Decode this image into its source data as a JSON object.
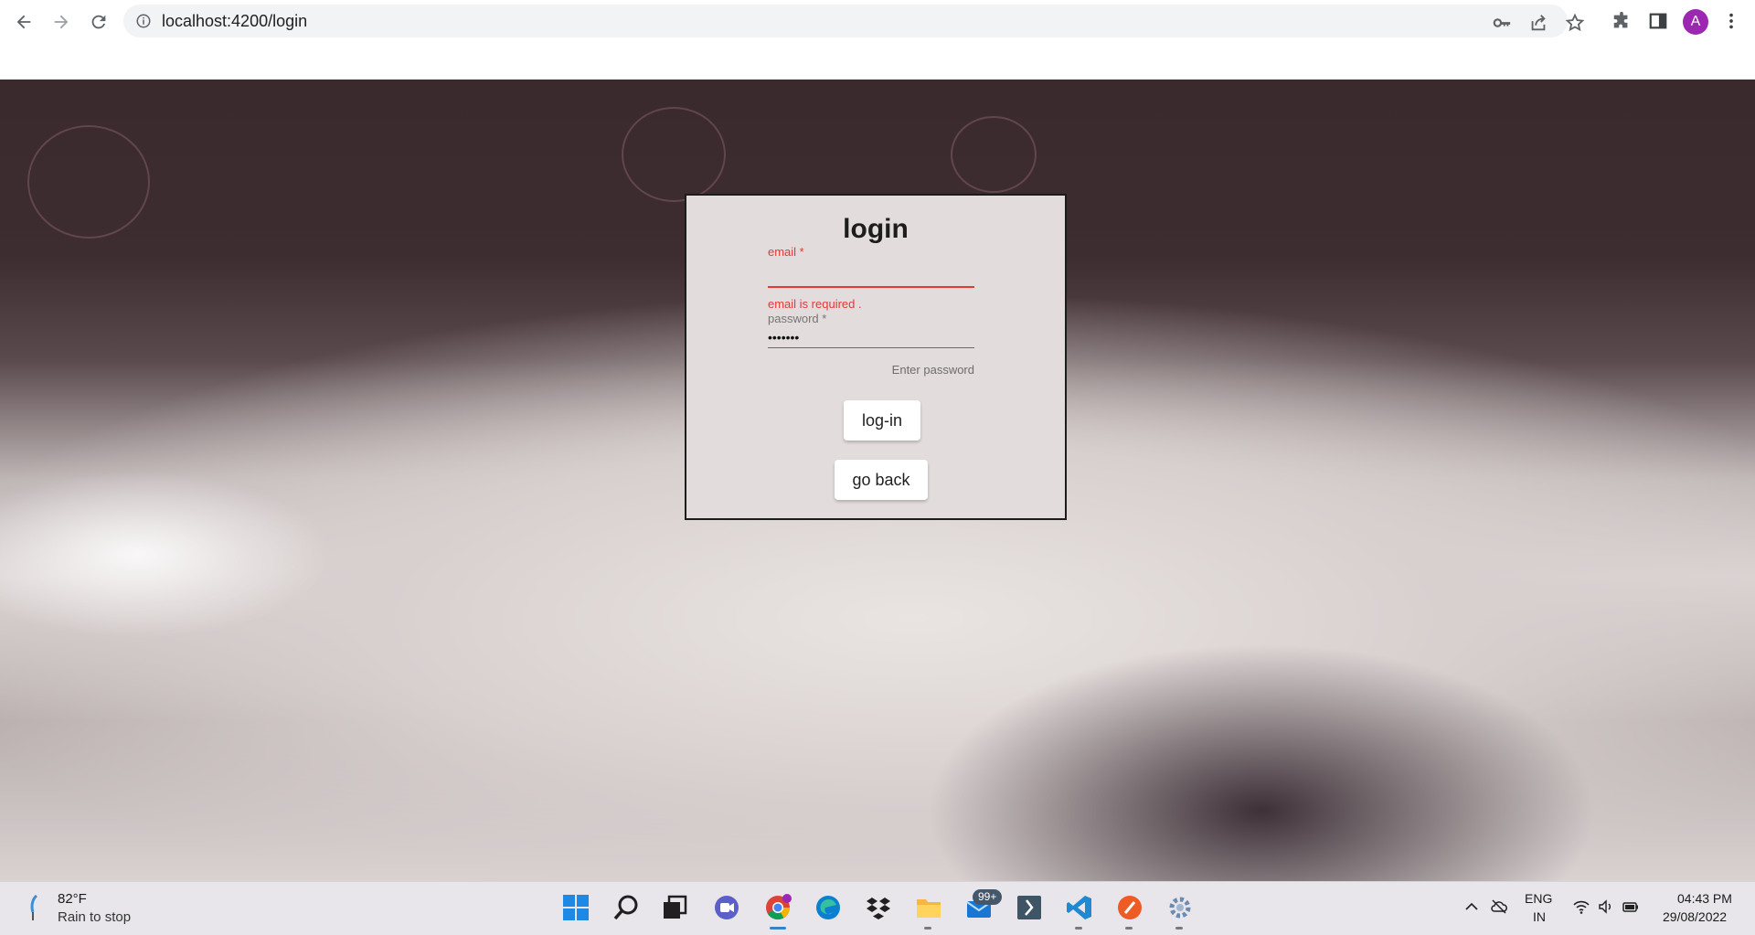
{
  "browser": {
    "url": "localhost:4200/login",
    "profile_initial": "A"
  },
  "login": {
    "title": "login",
    "email": {
      "label": "email *",
      "value": "",
      "error": "email is required ."
    },
    "password": {
      "label": "password *",
      "value": "1234567",
      "hint": "Enter password"
    },
    "login_button": "log-in",
    "back_button": "go back"
  },
  "taskbar": {
    "weather": {
      "temp": "82°F",
      "description": "Rain to stop"
    },
    "mail_badge": "99+",
    "language": {
      "line1": "ENG",
      "line2": "IN"
    },
    "clock": {
      "time": "04:43 PM",
      "date": "29/08/2022"
    }
  },
  "colors": {
    "error": "#e53935",
    "card_background": "#e3dcdc",
    "avatar": "#9c27b0",
    "taskbar": "#e8e6ea"
  },
  "icons": {
    "browser": [
      "back-icon",
      "forward-icon",
      "reload-icon",
      "site-info-icon",
      "key-icon",
      "share-icon",
      "star-icon",
      "extensions-icon",
      "side-panel-icon",
      "kebab-menu-icon"
    ],
    "taskbar": [
      "start-icon",
      "search-icon",
      "task-view-icon",
      "teams-icon",
      "chrome-icon",
      "edge-icon",
      "dropbox-icon",
      "file-explorer-icon",
      "mail-icon",
      "powershell-icon",
      "vscode-icon",
      "postman-icon",
      "settings-icon"
    ],
    "tray": [
      "chevron-up-icon",
      "cloud-off-icon",
      "wifi-icon",
      "volume-icon",
      "battery-icon"
    ]
  }
}
